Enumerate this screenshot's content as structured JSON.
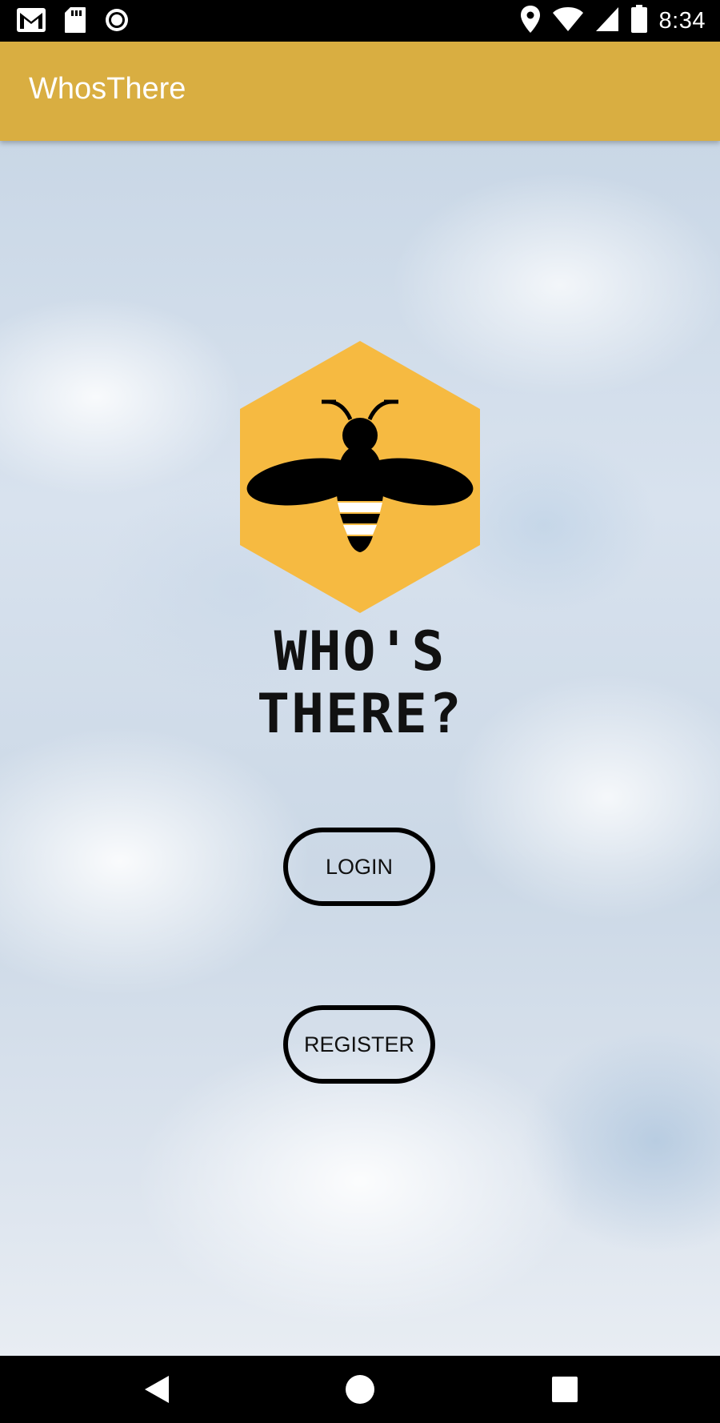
{
  "status_bar": {
    "time": "8:34",
    "icons": [
      "gmail-icon",
      "sd-card-icon",
      "record-icon",
      "location-icon",
      "wifi-icon",
      "signal-icon",
      "battery-icon"
    ]
  },
  "app_bar": {
    "title": "WhosThere",
    "color": "#D9AE41"
  },
  "logo": {
    "icon": "bee-hexagon-icon",
    "hex_color": "#F6BA41",
    "text_line1": "WHO'S",
    "text_line2": "THERE?"
  },
  "buttons": {
    "login_label": "LOGIN",
    "register_label": "REGISTER"
  },
  "nav_bar": {
    "icons": [
      "back-icon",
      "home-icon",
      "recents-icon"
    ]
  }
}
